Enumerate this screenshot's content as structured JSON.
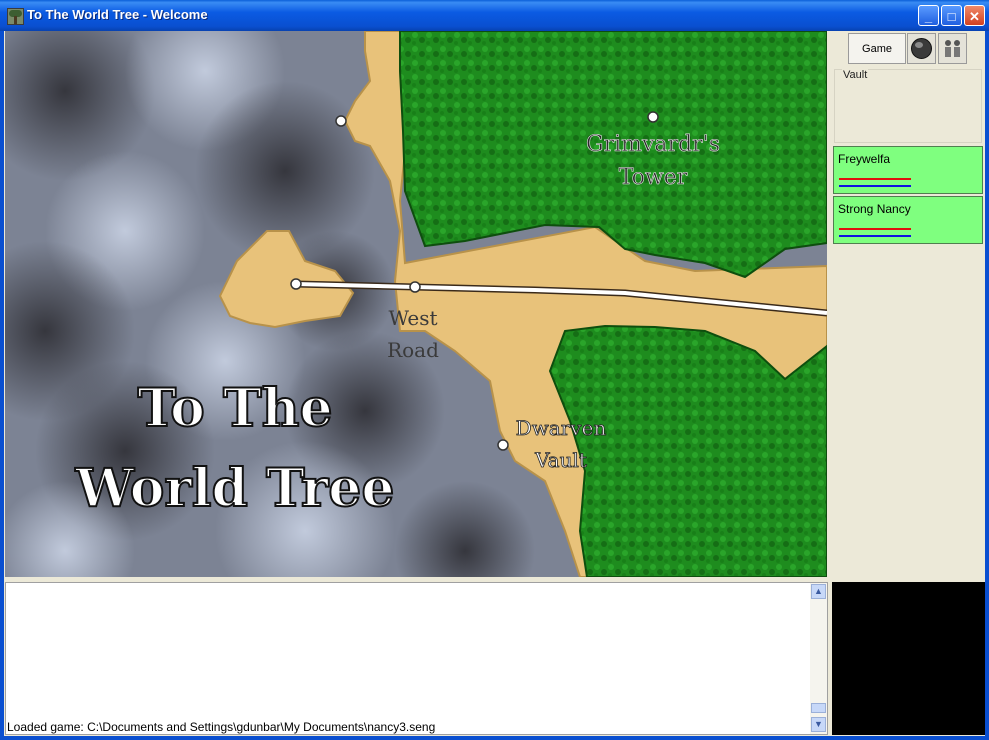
{
  "window": {
    "title": "To The World Tree - Welcome",
    "minimize_glyph": "_",
    "maximize_glyph": "□",
    "close_glyph": "✕"
  },
  "icons": {
    "app": "tree-icon",
    "globe": "globe-icon",
    "people": "party-icon",
    "scroll_up": "up-arrow-icon",
    "scroll_down": "down-arrow-icon"
  },
  "map": {
    "title_line1": "To The",
    "title_line2": "World Tree",
    "locations": [
      {
        "line1": "Grimvardr's",
        "line2": "Tower"
      },
      {
        "line1": "West",
        "line2": "Road"
      },
      {
        "line1": "Dwarven",
        "line2": "Vault"
      }
    ]
  },
  "side_panel": {
    "game_tab": "Game",
    "vault_label": "Vault",
    "party": [
      {
        "name": "Freywelfa"
      },
      {
        "name": "Strong Nancy"
      }
    ]
  },
  "log": {
    "text": "Loaded game: C:\\Documents and Settings\\gdunbar\\My Documents\\nancy3.seng"
  },
  "colors": {
    "titlebar": "#0A4FD0",
    "party_card": "#7FFF7F",
    "forest": "#1F8A1F",
    "sand": "#E8C27A",
    "panel": "#ECE9D8"
  }
}
